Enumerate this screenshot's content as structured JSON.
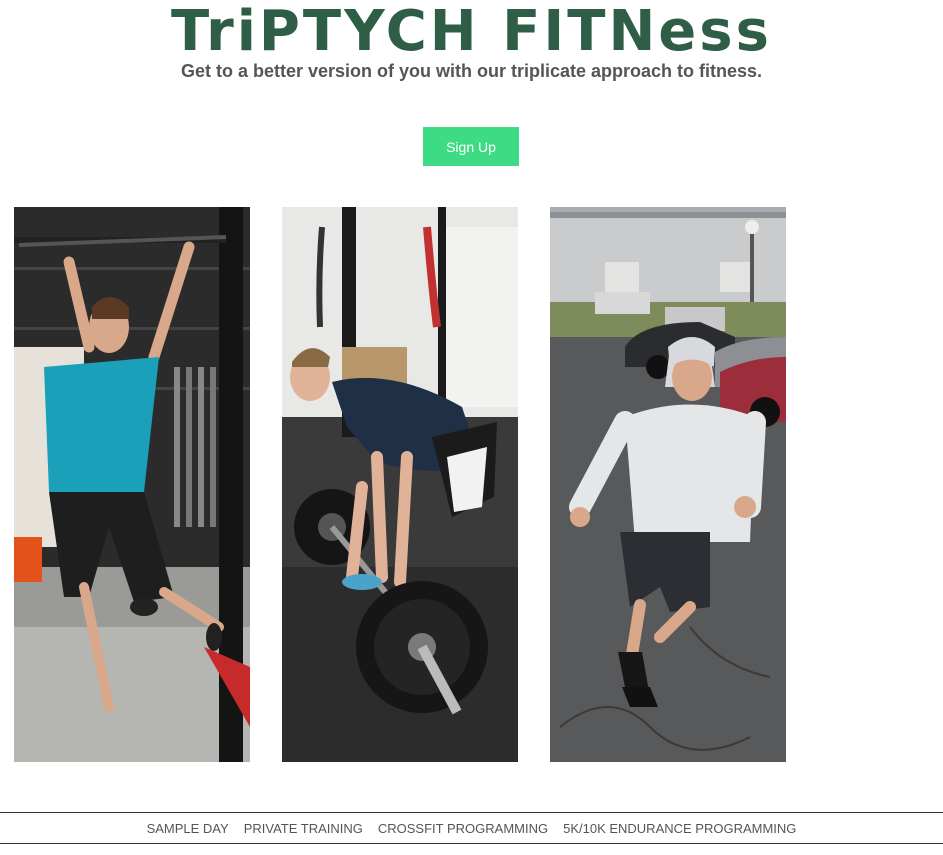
{
  "header": {
    "logo_text": "TriPTYCH FITNess",
    "tagline": "Get to a better version of you with our triplicate approach to fitness."
  },
  "signup": {
    "label": "Sign Up"
  },
  "colors": {
    "brand": "#2f5e46",
    "button": "#3ddc84",
    "text": "#555555"
  },
  "photos": [
    {
      "subject": "woman hanging from pull-up bar in gym"
    },
    {
      "subject": "man performing barbell deadlift"
    },
    {
      "subject": "man in hoodie running in parking lot"
    }
  ],
  "footer": {
    "links": [
      "SAMPLE DAY",
      "PRIVATE TRAINING",
      "CROSSFIT PROGRAMMING",
      "5K/10K ENDURANCE PROGRAMMING"
    ]
  }
}
